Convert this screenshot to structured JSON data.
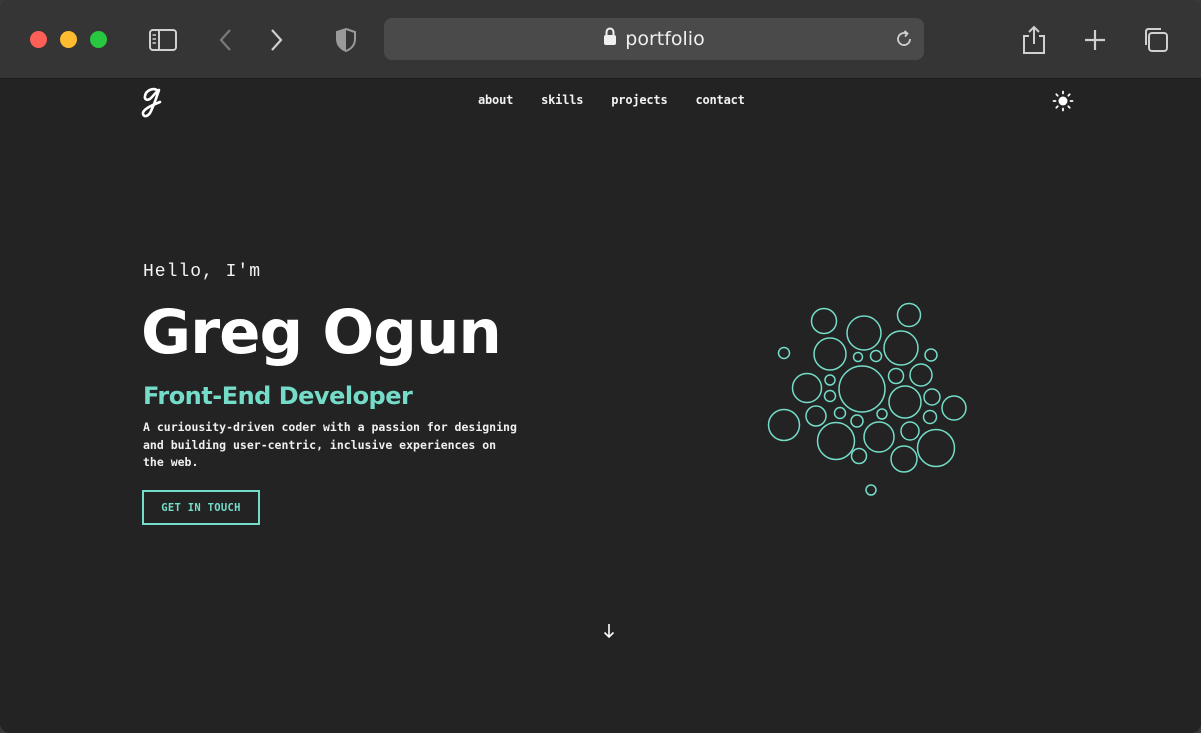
{
  "browser": {
    "url": "portfolio",
    "icons": {
      "sidebar": "sidebar-icon",
      "back": "chevron-left-icon",
      "forward": "chevron-right-icon",
      "privacy": "shield-icon",
      "lock": "lock-icon",
      "reload": "reload-icon",
      "share": "share-icon",
      "new_tab": "plus-icon",
      "tabs": "tabs-overview-icon"
    }
  },
  "nav": {
    "logo": "g-logo",
    "items": [
      {
        "label": "about"
      },
      {
        "label": "skills"
      },
      {
        "label": "projects"
      },
      {
        "label": "contact"
      }
    ],
    "theme_icon": "sun-icon"
  },
  "hero": {
    "greeting": "Hello, I'm",
    "name": "Greg Ogun",
    "role": "Front-End Developer",
    "description": "A curiousity-driven coder with a passion for designing and building user-centric, inclusive experiences on the web.",
    "cta_label": "GET IN TOUCH"
  },
  "scroll": {
    "icon": "arrow-down-icon"
  },
  "colors": {
    "accent": "#74dcc8",
    "page_background": "#232323",
    "chrome_background": "#353535",
    "address_bar": "#4a4a4a",
    "text": "#ffffff"
  }
}
